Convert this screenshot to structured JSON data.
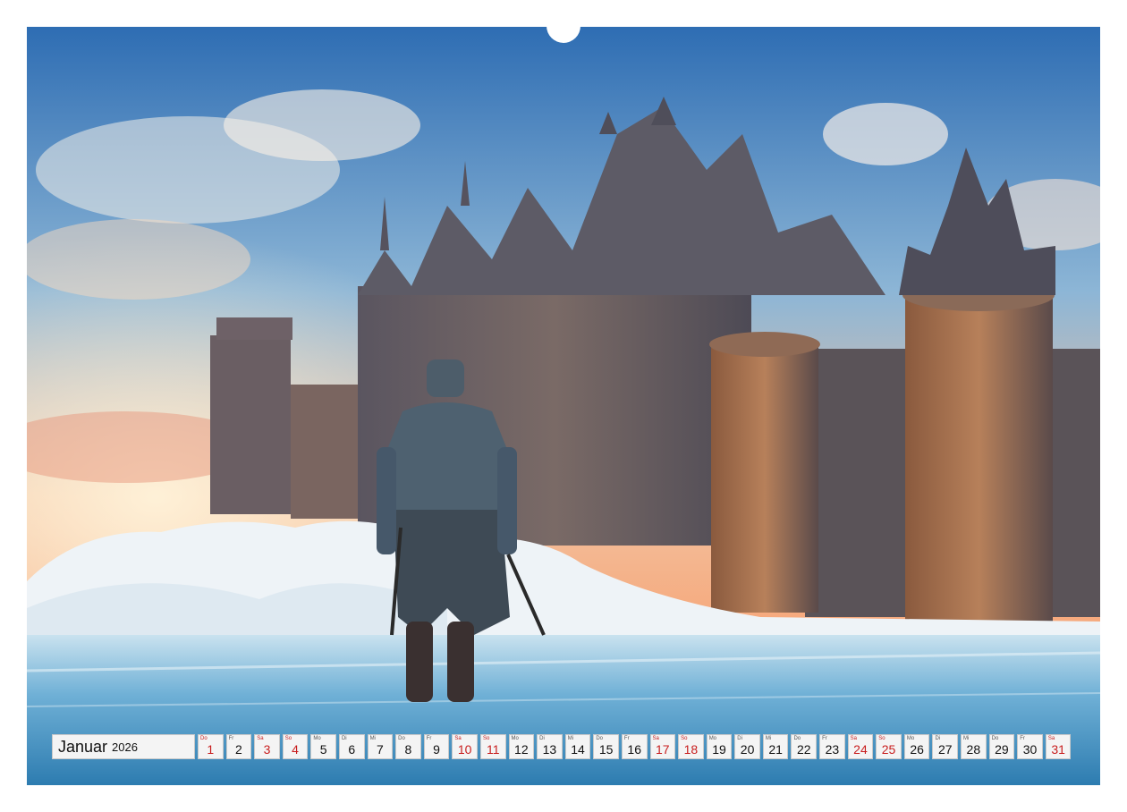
{
  "calendar": {
    "month": "Januar",
    "year": "2026",
    "days": [
      {
        "wd": "Do",
        "d": "1",
        "red": true
      },
      {
        "wd": "Fr",
        "d": "2",
        "red": false
      },
      {
        "wd": "Sa",
        "d": "3",
        "red": true
      },
      {
        "wd": "So",
        "d": "4",
        "red": true
      },
      {
        "wd": "Mo",
        "d": "5",
        "red": false
      },
      {
        "wd": "Di",
        "d": "6",
        "red": false
      },
      {
        "wd": "Mi",
        "d": "7",
        "red": false
      },
      {
        "wd": "Do",
        "d": "8",
        "red": false
      },
      {
        "wd": "Fr",
        "d": "9",
        "red": false
      },
      {
        "wd": "Sa",
        "d": "10",
        "red": true
      },
      {
        "wd": "So",
        "d": "11",
        "red": true
      },
      {
        "wd": "Mo",
        "d": "12",
        "red": false
      },
      {
        "wd": "Di",
        "d": "13",
        "red": false
      },
      {
        "wd": "Mi",
        "d": "14",
        "red": false
      },
      {
        "wd": "Do",
        "d": "15",
        "red": false
      },
      {
        "wd": "Fr",
        "d": "16",
        "red": false
      },
      {
        "wd": "Sa",
        "d": "17",
        "red": true
      },
      {
        "wd": "So",
        "d": "18",
        "red": true
      },
      {
        "wd": "Mo",
        "d": "19",
        "red": false
      },
      {
        "wd": "Di",
        "d": "20",
        "red": false
      },
      {
        "wd": "Mi",
        "d": "21",
        "red": false
      },
      {
        "wd": "Do",
        "d": "22",
        "red": false
      },
      {
        "wd": "Fr",
        "d": "23",
        "red": false
      },
      {
        "wd": "Sa",
        "d": "24",
        "red": true
      },
      {
        "wd": "So",
        "d": "25",
        "red": true
      },
      {
        "wd": "Mo",
        "d": "26",
        "red": false
      },
      {
        "wd": "Di",
        "d": "27",
        "red": false
      },
      {
        "wd": "Mi",
        "d": "28",
        "red": false
      },
      {
        "wd": "Do",
        "d": "29",
        "red": false
      },
      {
        "wd": "Fr",
        "d": "30",
        "red": false
      },
      {
        "wd": "Sa",
        "d": "31",
        "red": true
      }
    ]
  },
  "colors": {
    "weekend": "#c81e1e",
    "sky_top": "#2f6fb5",
    "sunset": "#f4b48a",
    "ice": "#7fb8d8",
    "castle": "#6b6a70"
  },
  "binding": {
    "holes_per_side": 30
  },
  "image": {
    "subject_icon": "knight-castle-photo"
  }
}
